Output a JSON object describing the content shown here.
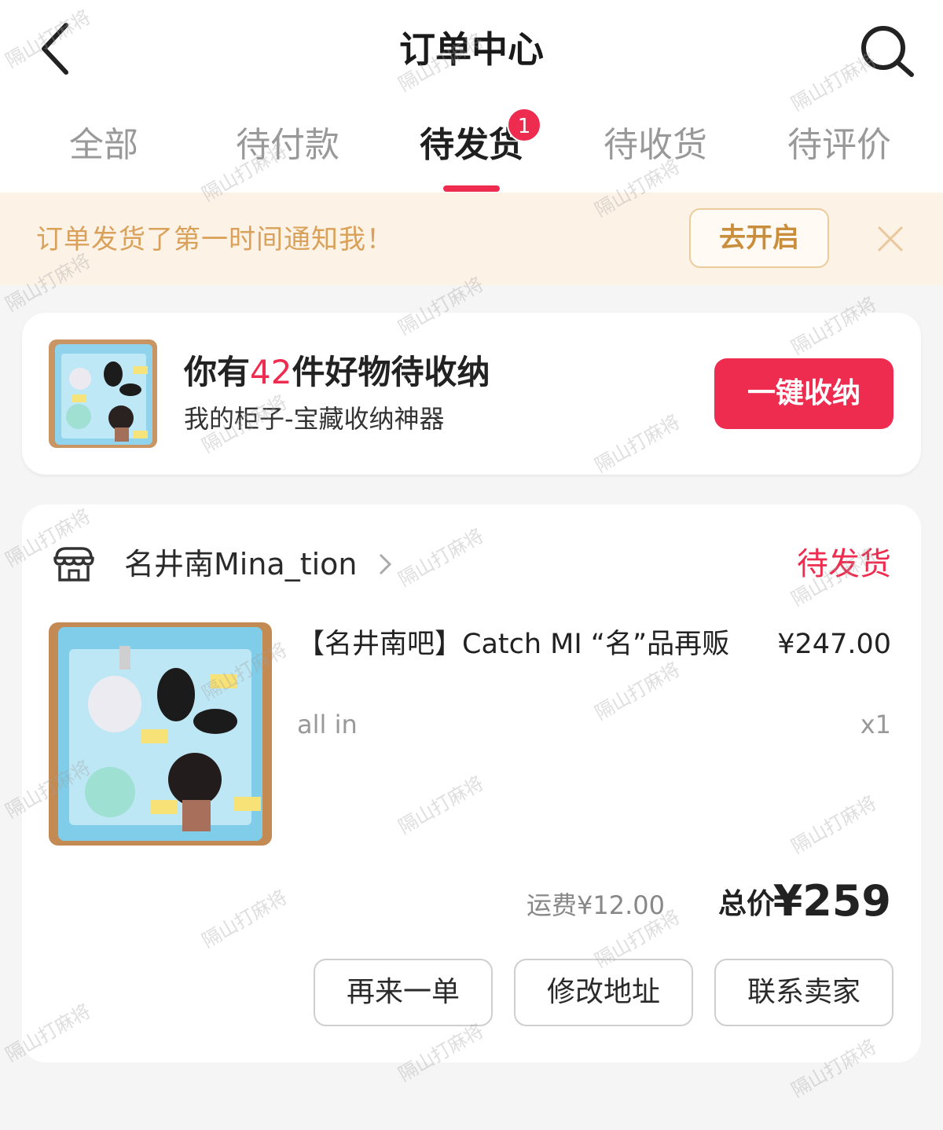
{
  "header": {
    "title": "订单中心"
  },
  "tabs": [
    {
      "label": "全部"
    },
    {
      "label": "待付款"
    },
    {
      "label": "待发货",
      "active": true,
      "badge": "1"
    },
    {
      "label": "待收货"
    },
    {
      "label": "待评价"
    }
  ],
  "notice": {
    "text": "订单发货了第一时间通知我！",
    "button_label": "去开启"
  },
  "cabinet": {
    "title_prefix": "你有",
    "count": "42",
    "title_suffix": "件好物待收纳",
    "subtitle": "我的柜子-宝藏收纳神器",
    "button_label": "一键收纳"
  },
  "order": {
    "shop_name": "名井南Mina_tion",
    "status": "待发货",
    "product": {
      "title": "【名井南吧】Catch MI “名”品再贩",
      "price": "¥247.00",
      "spec": "all in",
      "quantity": "x1"
    },
    "shipping": "运费¥12.00",
    "total_label": "总价",
    "total_value": "¥259",
    "actions": [
      "再来一单",
      "修改地址",
      "联系卖家"
    ]
  },
  "watermark": "隔山打麻将",
  "colors": {
    "accent": "#ee2c4f",
    "notice_bg": "#fdf2e6",
    "notice_text": "#d9a15a"
  }
}
